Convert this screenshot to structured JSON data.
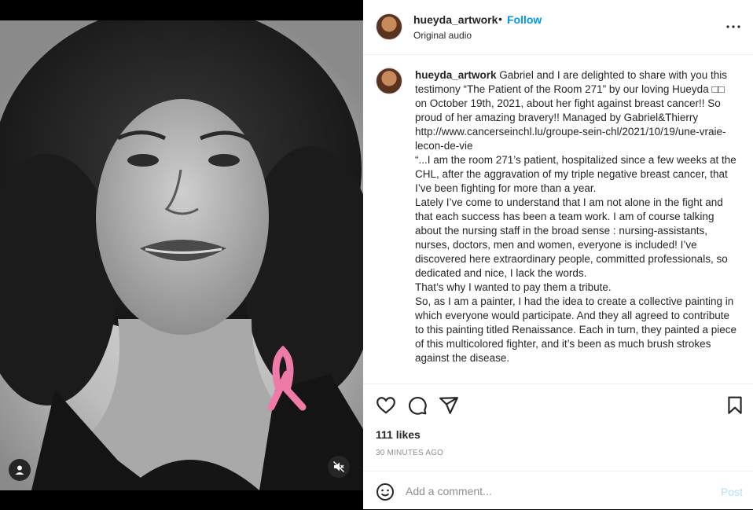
{
  "header": {
    "username": "hueyda_artwork",
    "separator": "•",
    "follow_label": "Follow",
    "audio_label": "Original audio",
    "more_icon": "more-horizontal-icon"
  },
  "caption": {
    "username": "hueyda_artwork",
    "text": " Gabriel and I are delighted to share with you this testimony “The Patient of the Room 271” by our loving Hueyda □□ on October 19th, 2021, about her fight against breast cancer!! So proud of her amazing bravery!! Managed by Gabriel&Thierry\nhttp://www.cancerseinchl.lu/groupe-sein-chl/2021/10/19/une-vraie-lecon-de-vie\n“...I am the room 271’s patient, hospitalized since a few weeks at the CHL, after the aggravation of my triple negative breast cancer, that I’ve been fighting for more than a year.\nLately I’ve come to understand that I am not alone in the fight and that each success has been a team work. I am of course talking about the nursing staff in the broad sense : nursing-assistants, nurses, doctors, men and women, everyone is included! I’ve discovered here extraordinary people, committed professionals, so dedicated and nice, I lack the words.\nThat’s why I wanted to pay them a tribute.\nSo, as I am a painter, I had the idea to create a collective painting in which everyone would participate. And they all agreed to contribute to this painting titled Renaissance. Each in turn, they painted a piece of this multicolored fighter, and it’s been as much brush strokes against the disease."
  },
  "actions": {
    "icons": [
      "heart-icon",
      "comment-icon",
      "share-icon",
      "bookmark-icon"
    ],
    "likes": "111 likes",
    "time_ago": "30 MINUTES AGO"
  },
  "comment": {
    "placeholder": "Add a comment...",
    "post_label": "Post",
    "emoji_icon": "emoji-icon"
  },
  "media": {
    "icons": [
      "user-tag-icon",
      "audio-muted-icon",
      "pink-ribbon-icon"
    ]
  },
  "colors": {
    "link": "#0095f6",
    "post_disabled": "#b2dffc",
    "secondary_text": "#8e8e8e",
    "ribbon": "#f07aa8"
  }
}
